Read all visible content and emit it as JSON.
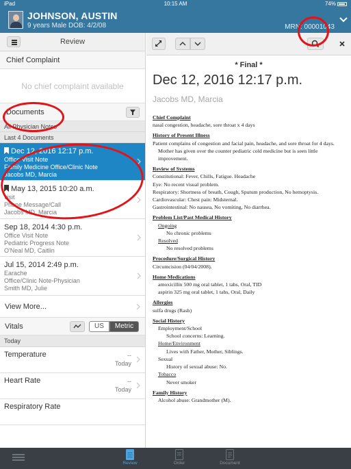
{
  "status_bar": {
    "device": "iPad",
    "time": "10:15 AM",
    "battery": "74%"
  },
  "patient": {
    "name": "JOHNSON, AUSTIN",
    "demographics": "9 years  Male  DOB: 4/2/08",
    "mrn": "MRN: 00001043"
  },
  "left": {
    "review_title": "Review",
    "chief_complaint_title": "Chief Complaint",
    "chief_complaint_empty": "No chief complaint available",
    "documents_title": "Documents",
    "filters": [
      "All Physician Notes",
      "Last 4 Documents"
    ],
    "documents": [
      {
        "title": "Dec 12, 2016 12:17 p.m.",
        "type": "Office Visit Note",
        "category": "Family Medicine Office/Clinic Note",
        "author": "Jacobs MD, Marcia",
        "bookmarked": true,
        "selected": true
      },
      {
        "title": "May 13, 2015 10:20 a.m.",
        "type": "visit",
        "category": "Phone Message/Call",
        "author": "Jacobs MD, Marcia",
        "bookmarked": true,
        "selected": false
      },
      {
        "title": "Sep 18, 2014 4:30 p.m.",
        "type": "Office Visit Note",
        "category": "Pediatric Progress Note",
        "author": "O'Neal MD, Caitlin",
        "bookmarked": false,
        "selected": false
      },
      {
        "title": "Jul 15, 2014 2:49 p.m.",
        "type": "Earache",
        "category": "Office/Clinic Note-Physician",
        "author": "Smith MD, Julie",
        "bookmarked": false,
        "selected": false
      }
    ],
    "view_more": "View More...",
    "vitals_title": "Vitals",
    "unit_us": "US",
    "unit_metric": "Metric",
    "vitals_today": "Today",
    "vitals": [
      {
        "name": "Temperature",
        "value": "--",
        "when": "Today"
      },
      {
        "name": "Heart Rate",
        "value": "--",
        "when": "Today"
      },
      {
        "name": "Respiratory Rate",
        "value": "",
        "when": ""
      }
    ]
  },
  "document": {
    "status": "* Final *",
    "datetime": "Dec 12, 2016 12:17 p.m.",
    "author": "Jacobs MD, Marcia",
    "chief_complaint_h": "Chief Complaint",
    "chief_complaint": "nasal congestion, headache, sore throat x 4 days",
    "hpi_h": "History of Present Illness",
    "hpi_1": "Patient complains of congestion and facial pain, headache, and sore throat for 4 days.",
    "hpi_2": "Mother has given over the counter pediatric cold medicine but is seen little improvement.",
    "ros_h": "Review of Systems",
    "ros": [
      "Constitutional: Fever, Chills, Fatigue.  Headache",
      "Eye: No recent visual problem.",
      "Respiratory: Shortness of breath, Cough, Sputum production, No hemoptysis.",
      "Cardiovascular: Chest pain: Midsternal.",
      "Gastrointestinal: No nausea, No vomiting, No diarrhea."
    ],
    "problem_h": "Problem List/Past Medical History",
    "ongoing_h": "Ongoing",
    "ongoing": "No chronic problems",
    "resolved_h": "Resolved",
    "resolved": "No resolved problems",
    "procedure_h": "Procedure/Surgical History",
    "procedure": "Circumcision (04/04/2008).",
    "meds_h": "Home Medications",
    "meds": [
      "amoxicillin 500 mg oral tablet, 1 tabs, Oral, TID",
      "aspirin 325 mg oral tablet, 1 tabs, Oral, Daily"
    ],
    "allergies_h": "Allergies",
    "allergies": "sulfa drugs (Rash)",
    "social_h": "Social History",
    "employment_h": "Employment/School",
    "employment": "School concerns: Learning.",
    "home_h": "Home/Environment",
    "home": "Lives with Father, Mother, Siblings.",
    "sexual_h": "Sexual",
    "sexual": "History of sexual abuse: No.",
    "tobacco_h": "Tobacco",
    "tobacco": "Never smoker",
    "family_h": "Family History",
    "family": "Alcohol abuse: Grandmother (M)."
  },
  "tabbar": {
    "tabs": [
      "Review",
      "Order",
      "Document"
    ],
    "active": "Review"
  },
  "colors": {
    "header": "#36779f",
    "selection": "#1f86c6",
    "tabbar": "#3a3f45",
    "annotation": "#e2141a"
  }
}
